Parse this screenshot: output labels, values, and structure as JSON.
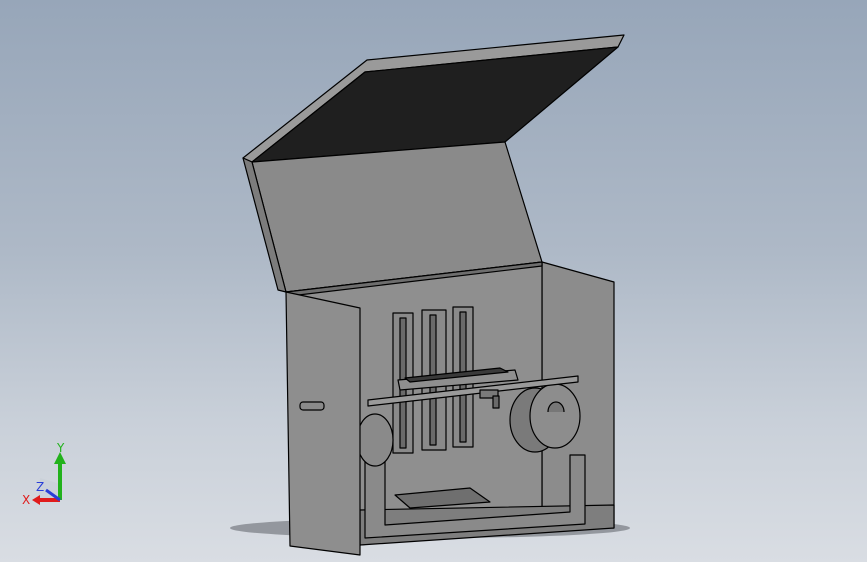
{
  "viewport": {
    "background_top": "#97a6b9",
    "background_bottom": "#d9dde3"
  },
  "model": {
    "body_color": "#8a8a8a",
    "dark_panel_color": "#1f1f1f",
    "edge_color": "#000000"
  },
  "triad": {
    "x_label": "X",
    "y_label": "Y",
    "z_label": "Z",
    "x_color": "#e01b1b",
    "y_color": "#22b21c",
    "z_color": "#2a3fd8"
  }
}
